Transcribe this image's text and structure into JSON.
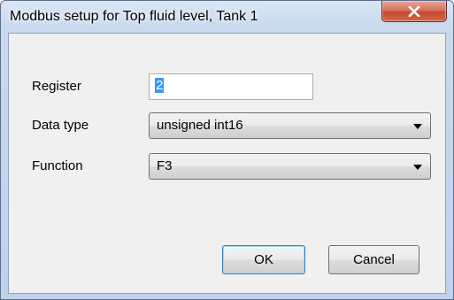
{
  "window": {
    "title": "Modbus setup for Top fluid level, Tank 1",
    "close_icon": "close-x-icon"
  },
  "form": {
    "register": {
      "label": "Register",
      "value": "2"
    },
    "data_type": {
      "label": "Data type",
      "selected": "unsigned int16"
    },
    "function": {
      "label": "Function",
      "selected": "F3"
    }
  },
  "buttons": {
    "ok": "OK",
    "cancel": "Cancel"
  },
  "colors": {
    "client_bg": "#f0f0f0",
    "selection": "#3399ff",
    "close_button": "#c24a2f"
  }
}
